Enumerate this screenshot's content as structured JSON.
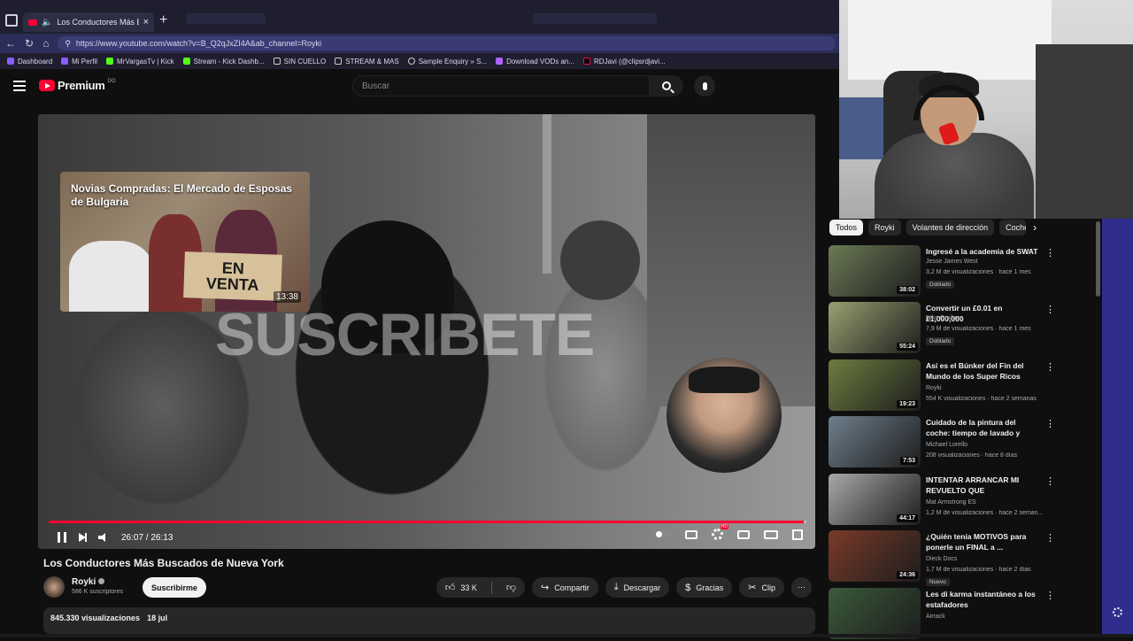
{
  "browser": {
    "tab_title": "Los Conductores Más Buscados...",
    "url": "https://www.youtube.com/watch?v=B_Q2qJxZI4A&ab_channel=Royki",
    "bookmarks": [
      "Dashboard",
      "Mi Perfil",
      "MrVargasTv | Kick",
      "Stream - Kick Dashb...",
      "SIN CUELLO",
      "STREAM & MAS",
      "Sample Enquiry » S...",
      "Download VODs an...",
      "RDJavi (@clipsrdjavi..."
    ]
  },
  "header": {
    "logo_text": "Premium",
    "logo_region": "DO",
    "search_placeholder": "Buscar"
  },
  "player": {
    "endcard_title": "Novias Compradas: El Mercado de Esposas de Bulgaria",
    "endcard_sign_line1": "EN",
    "endcard_sign_line2": "VENTA",
    "endcard_duration": "13:38",
    "watermark": "SUSCRIBETE",
    "time": "26:07 / 26:13",
    "progress": 0.996
  },
  "video": {
    "title": "Los Conductores Más Buscados de Nueva York",
    "channel": "Royki",
    "subscribers": "586 K suscriptores",
    "subscribe_label": "Suscribirme",
    "likes": "33 K",
    "share_label": "Compartir",
    "download_label": "Descargar",
    "thanks_label": "Gracias",
    "clip_label": "Clip",
    "views": "845.330 visualizaciones",
    "date": "18 jul"
  },
  "sidebar": {
    "chips": [
      "Todos",
      "Royki",
      "Volantes de dirección",
      "Coche"
    ],
    "recommendations": [
      {
        "title": "Ingresé a la academia de SWAT",
        "channel": "Jesse James West",
        "meta": "3,2 M de visualizaciones · hace 1 mes",
        "badge": "Doblado",
        "duration": "38:02",
        "color": "#6b7a55"
      },
      {
        "title": "Convertir un £0.01 en £1,000,000",
        "channel": "Niko Omilana",
        "meta": "7,9 M de visualizaciones · hace 1 mes",
        "badge": "Doblado",
        "duration": "55:24",
        "color": "#9aa071"
      },
      {
        "title": "Así es el Búnker del Fin del Mundo de los Super Ricos",
        "channel": "Royki",
        "meta": "554 K visualizaciones · hace 2 semanas",
        "badge": "",
        "duration": "19:23",
        "color": "#6c7d3f"
      },
      {
        "title": "Cuidado de la pintura del coche: tiempo de lavado y encerado, ...",
        "channel": "Michael Lorello",
        "meta": "208 visualizaciones · hace 8 días",
        "badge": "",
        "duration": "7:53",
        "color": "#6e7f8c"
      },
      {
        "title": "INTENTAR ARRANCAR MI REVUELTO QUE LAMBORGHIN...",
        "channel": "Mat Armstrong ES",
        "meta": "1,2 M de visualizaciones · hace 2 seman...",
        "badge": "",
        "duration": "44:17",
        "color": "#a8a8a8"
      },
      {
        "title": "¿Quién tenía MOTIVOS para ponerle un FINAL a ...",
        "channel": "Dieck Docs",
        "meta": "1,7 M de visualizaciones · hace 2 días",
        "badge": "Nuevo",
        "duration": "24:36",
        "color": "#7a3a2a"
      },
      {
        "title": "Les di karma instantáneo a los estafadores",
        "channel": "Airrack",
        "meta": "",
        "badge": "",
        "duration": "",
        "color": "#3a5a3a"
      }
    ]
  }
}
